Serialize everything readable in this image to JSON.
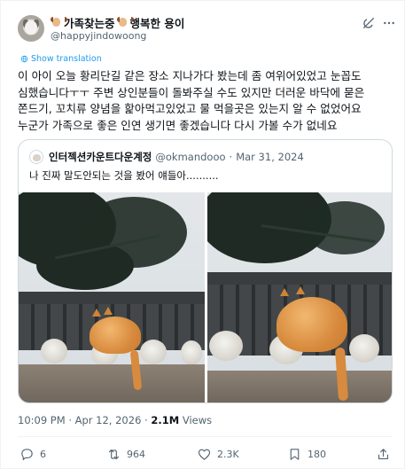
{
  "author": {
    "display_name_1": "가족찾는중",
    "display_name_2": "행복한 용이",
    "handle": "@happyjindowoong"
  },
  "show_translation": "Show translation",
  "post_text": "이 아이 오늘 황리단길 같은 장소 지나가다 봤는데 좀 여위어있었고 눈꼽도 심했습니다ㅜㅜ 주변 상인분들이 돌봐주실 수도 있지만 더러운 바닥에 묻은 쫀드기, 꼬치류 양념을 핥아먹고있었고 물 먹을곳은 있는지 알 수 없었어요\n누군가 가족으로 좋은 인연 생기면 좋겠습니다 다시 가볼 수가 없네요",
  "quote": {
    "display_name": "인터젝션카운트다운계정",
    "handle": "@okmandooo",
    "separator": "·",
    "date": "Mar 31, 2024",
    "text": "나 진짜 말도안되는 것을 봤어 얘들아.........."
  },
  "meta": {
    "time": "10:09 PM",
    "separator": "·",
    "date": "Apr 12, 2026",
    "views_count": "2.1M",
    "views_label": "Views"
  },
  "actions": {
    "replies": "6",
    "reposts": "964",
    "likes": "2.3K",
    "bookmarks": "180"
  },
  "icons": {
    "grok": "grok-icon",
    "more": "more-icon",
    "translate": "globe-icon",
    "reply": "reply-icon",
    "repost": "repost-icon",
    "like": "heart-icon",
    "bookmark": "bookmark-icon",
    "share": "share-icon"
  },
  "colors": {
    "link": "#1d9bf0",
    "secondary_text": "#536471",
    "primary_text": "#0f1419",
    "border": "#cfd9de"
  }
}
